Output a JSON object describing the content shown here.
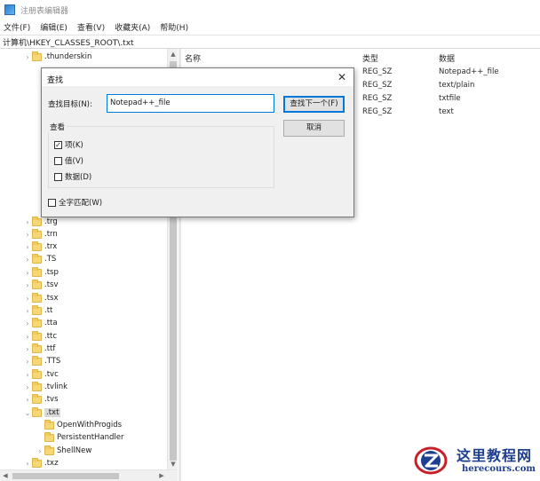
{
  "window": {
    "title": "注册表编辑器"
  },
  "menu": [
    "文件(F)",
    "编辑(E)",
    "查看(V)",
    "收藏夹(A)",
    "帮助(H)"
  ],
  "address": "计算机\\HKEY_CLASSES_ROOT\\.txt",
  "tree": {
    "items": [
      {
        "label": ".thunderskin",
        "expander": "›"
      },
      {
        "label": ".trg",
        "expander": "›"
      },
      {
        "label": ".trn",
        "expander": "›"
      },
      {
        "label": ".trx",
        "expander": "›"
      },
      {
        "label": ".TS",
        "expander": "›"
      },
      {
        "label": ".tsp",
        "expander": "›"
      },
      {
        "label": ".tsv",
        "expander": "›"
      },
      {
        "label": ".tsx",
        "expander": "›"
      },
      {
        "label": ".tt",
        "expander": "›"
      },
      {
        "label": ".tta",
        "expander": "›"
      },
      {
        "label": ".ttc",
        "expander": "›"
      },
      {
        "label": ".ttf",
        "expander": "›"
      },
      {
        "label": ".TTS",
        "expander": "›"
      },
      {
        "label": ".tvc",
        "expander": "›"
      },
      {
        "label": ".tvlink",
        "expander": "›"
      },
      {
        "label": ".tvs",
        "expander": "›"
      },
      {
        "label": ".txt",
        "expander": "⌄"
      },
      {
        "label": "OpenWithProgids",
        "expander": ""
      },
      {
        "label": "PersistentHandler",
        "expander": ""
      },
      {
        "label": "ShellNew",
        "expander": "›"
      },
      {
        "label": ".txz",
        "expander": "›"
      }
    ]
  },
  "list": {
    "headers": {
      "name": "名称",
      "type": "类型",
      "data": "数据"
    },
    "rows": [
      {
        "type": "REG_SZ",
        "data": "Notepad++_file"
      },
      {
        "type": "REG_SZ",
        "data": "text/plain"
      },
      {
        "type": "REG_SZ",
        "data": "txtfile"
      },
      {
        "type": "REG_SZ",
        "data": "text"
      }
    ]
  },
  "dialog": {
    "title": "查找",
    "close_glyph": "✕",
    "find_label": "查找目标(N):",
    "find_value": "Notepad++_file",
    "find_next_button": "查找下一个(F)",
    "cancel_button": "取消",
    "look_at": {
      "title": "查看",
      "keys": {
        "label": "项(K)",
        "checked": true
      },
      "values": {
        "label": "值(V)",
        "checked": false
      },
      "data": {
        "label": "数据(D)",
        "checked": false
      }
    },
    "match_whole": {
      "label": "全字匹配(W)",
      "checked": false
    }
  },
  "watermark": {
    "name": "这里教程网",
    "url": "herecours.com"
  },
  "colors": {
    "accent": "#0078d7",
    "folder": "#f6d776",
    "watermark": "#1e3f8f"
  }
}
